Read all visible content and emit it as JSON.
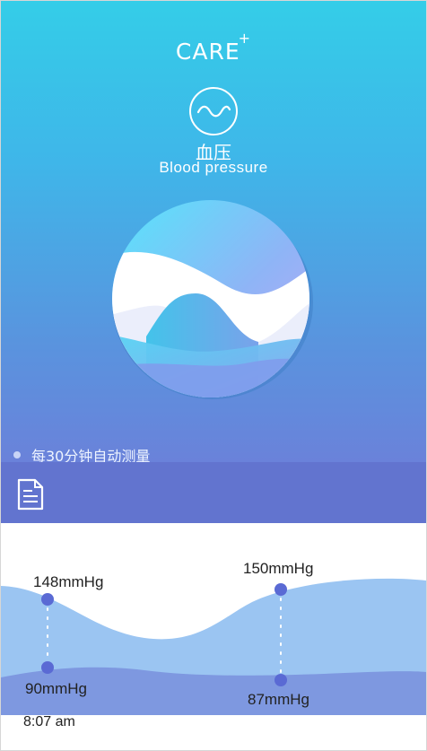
{
  "brand": {
    "name": "CARE",
    "plus": "+"
  },
  "metric": {
    "title_cn": "血压",
    "title_en": "Blood pressure"
  },
  "note": "每30分钟自动测量",
  "readings": [
    {
      "systolic": "148mmHg",
      "diastolic": "90mmHg"
    },
    {
      "systolic": "150mmHg",
      "diastolic": "87mmHg"
    }
  ],
  "time": "8:07 am",
  "icons": {
    "wave": "wave-icon",
    "document": "document-icon"
  },
  "colors": {
    "accent": "#6274cf",
    "sky": "#34cde8",
    "point": "#5a6ad4"
  }
}
